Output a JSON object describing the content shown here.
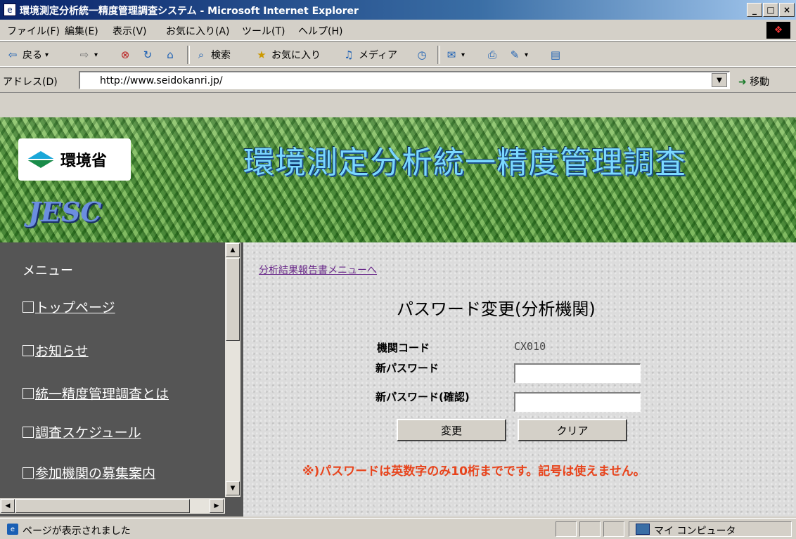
{
  "window": {
    "title": "環境測定分析統一精度管理調査システム - Microsoft Internet Explorer",
    "app_icon": "ie-icon",
    "controls": {
      "minimize": "_",
      "maximize": "□",
      "close": "×"
    }
  },
  "menubar": {
    "items": [
      "ファイル(F)",
      "編集(E)",
      "表示(V)",
      "お気に入り(A)",
      "ツール(T)",
      "ヘルプ(H)"
    ]
  },
  "toolbar": {
    "back": "戻る",
    "search": "検索",
    "favorites": "お気に入り",
    "media": "メディア"
  },
  "addressbar": {
    "label": "アドレス(D)",
    "url": "http://www.seidokanri.jp/",
    "go": "移動"
  },
  "banner": {
    "logo_text": "環境省",
    "title": "環境測定分析統一精度管理調査",
    "jesc": "JESC"
  },
  "sidebar": {
    "heading": "メニュー",
    "items": [
      {
        "label": "トップページ"
      },
      {
        "label": "お知らせ"
      },
      {
        "label": "統一精度管理調査とは"
      },
      {
        "label": "調査スケジュール"
      },
      {
        "label": "参加機関の募集案内"
      }
    ]
  },
  "content": {
    "back_link": "分析結果報告書メニューへ",
    "form_title": "パスワード変更(分析機関)",
    "fields": {
      "code_label": "機関コード",
      "code_value": "CX010",
      "new_password_label": "新パスワード",
      "new_password_value": "",
      "confirm_password_label": "新パスワード(確認)",
      "confirm_password_value": ""
    },
    "buttons": {
      "change": "変更",
      "clear": "クリア"
    },
    "notice": "※)パスワードは英数字のみ10桁までです。記号は使えません。",
    "notice_color": "#e8441c"
  },
  "statusbar": {
    "text": "ページが表示されました",
    "zone": "マイ コンピュータ"
  }
}
